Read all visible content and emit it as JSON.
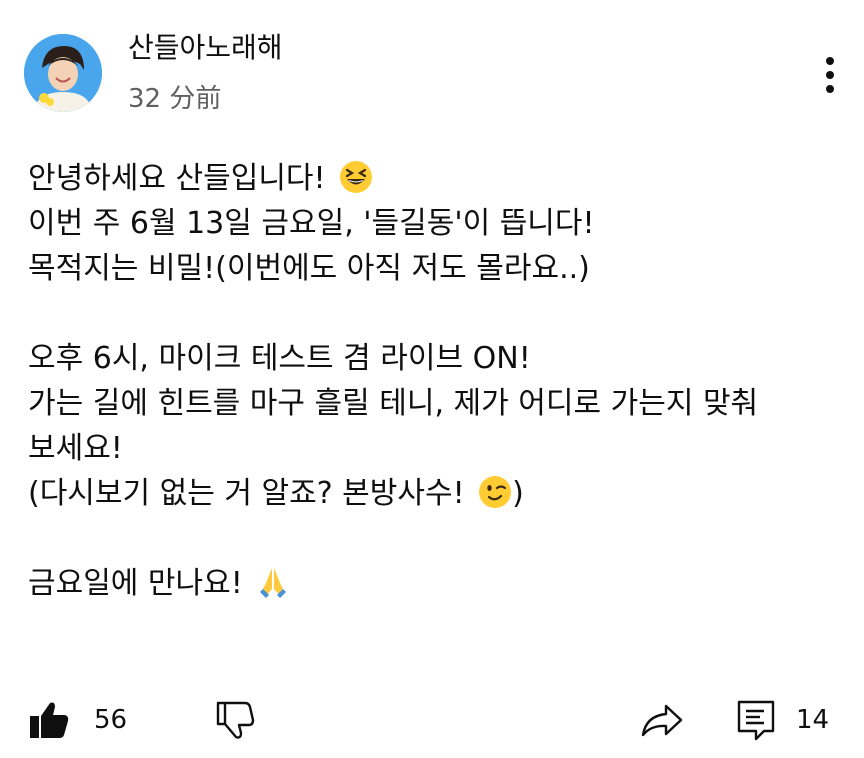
{
  "channel": {
    "name": "산들아노래해",
    "time_ago": "32 分前"
  },
  "post": {
    "lines": [
      "안녕하세요 산들입니다!",
      "이번 주 6월 13일 금요일, '들길동'이 뜹니다!",
      "목적지는 비밀!(이번에도  아직 저도 몰라요..)",
      "오후 6시, 마이크 테스트 겸 라이브 ON!",
      "가는 길에 힌트를 마구 흘릴 테니, 제가 어디로 가는지 맞춰",
      "보세요!",
      "(다시보기 없는 거 알죠? 본방사수!",
      ")",
      "금요일에 만나요!"
    ]
  },
  "actions": {
    "like_count": "56",
    "comment_count": "14"
  },
  "icons": {
    "avatar": "avatar-photo",
    "menu": "more-vert-icon",
    "like": "thumbs-up-icon",
    "dislike": "thumbs-down-icon",
    "share": "share-icon",
    "comment": "comment-icon",
    "emoji_laugh": "grinning-squinting-face-emoji",
    "emoji_wink": "winking-face-emoji",
    "emoji_pray": "folded-hands-emoji"
  },
  "colors": {
    "text": "#0f0f0f",
    "secondary": "#606060",
    "emoji_yellow": "#ffcc33"
  }
}
